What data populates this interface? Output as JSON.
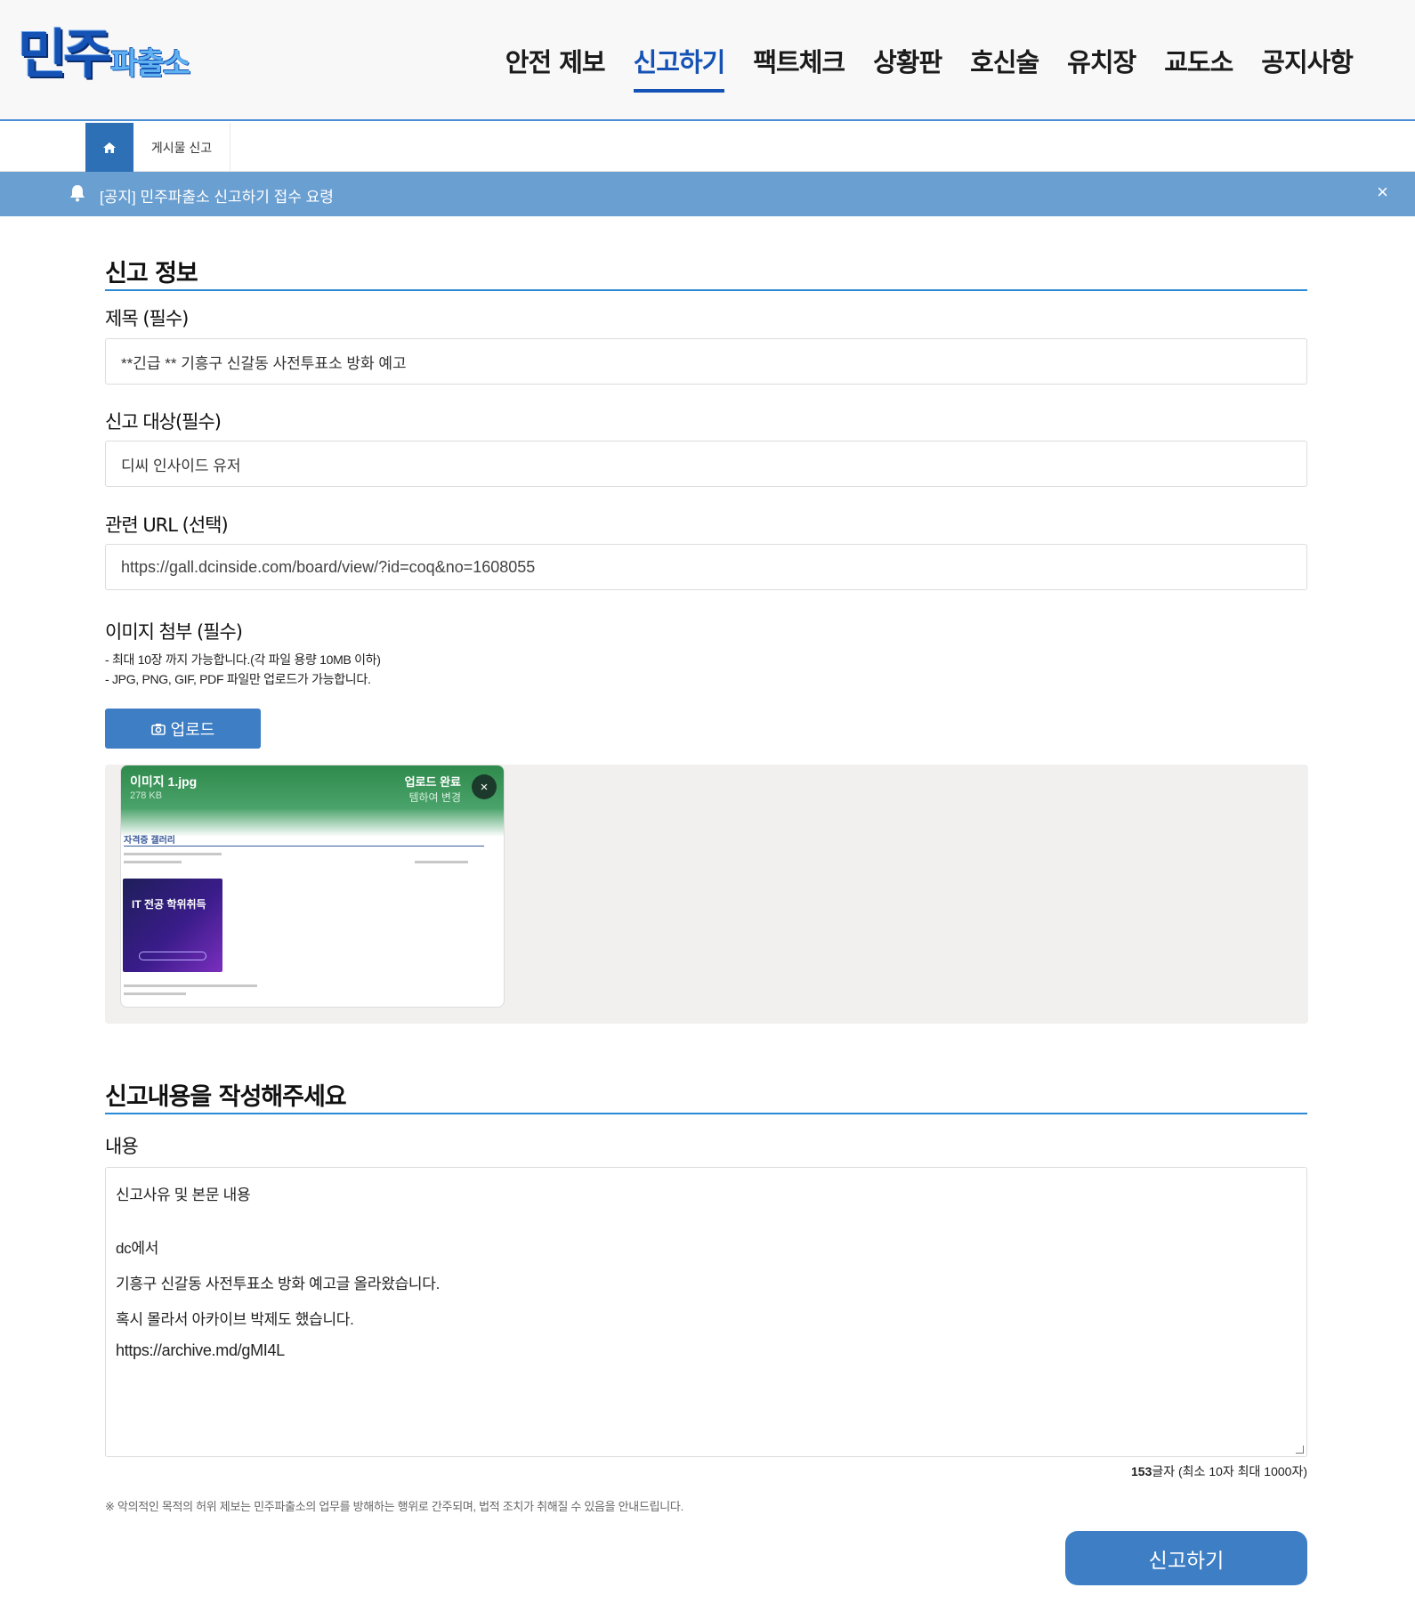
{
  "header": {
    "logo_main": "민주",
    "logo_sub": "파출소",
    "nav": [
      "안전 제보",
      "신고하기",
      "팩트체크",
      "상황판",
      "호신술",
      "유치장",
      "교도소",
      "공지사항"
    ],
    "active_index": 1,
    "accent_color": "#1552b5"
  },
  "breadcrumb": {
    "home_icon": "home-icon",
    "current": "게시물 신고"
  },
  "notice": {
    "icon": "bell-icon",
    "text": "[공지] 민주파출소 신고하기 접수 요령",
    "close": "×"
  },
  "form": {
    "section1_title": "신고 정보",
    "title_label": "제목 (필수)",
    "title_value": "**긴급 **   기흥구 신갈동 사전투표소 방화 예고",
    "target_label": "신고 대상(필수)",
    "target_value": "디씨 인사이드  유저",
    "url_label": "관련 URL (선택)",
    "url_value": "https://gall.dcinside.com/board/view/?id=coq&no=1608055",
    "image_label": "이미지 첨부 (필수)",
    "image_hint1": "- 최대 10장 까지 가능합니다.(각 파일 용량 10MB 이하)",
    "image_hint2": "- JPG, PNG, GIF, PDF 파일만 업로드가 가능합니다.",
    "upload_label": "업로드",
    "upload_icon": "camera-icon"
  },
  "attachment": {
    "name": "이미지 1.jpg",
    "size": "278 KB",
    "status": "업로드 완료",
    "change": "템하여 변경",
    "close": "×",
    "gallery": "자격증 갤러리",
    "ad_title": "IT 전공 학위취득"
  },
  "content": {
    "section2_title": "신고내용을 작성해주세요",
    "body_label": "내용",
    "lines": [
      "신고사유 및 본문 내용",
      "dc에서",
      "기흥구 신갈동 사전투표소 방화 예고글 올라왔습니다.",
      "혹시 몰라서 아카이브 박제도 했습니다.",
      "https://archive.md/gMI4L"
    ],
    "count": "153",
    "count_suffix": "글자 (최소 10자 최대 1000자)",
    "disclaimer": "※ 악의적인 목적의 허위 제보는 민주파출소의 업무를 방해하는 행위로 간주되며, 법적 조치가 취해질 수 있음을 안내드립니다.",
    "submit": "신고하기"
  }
}
